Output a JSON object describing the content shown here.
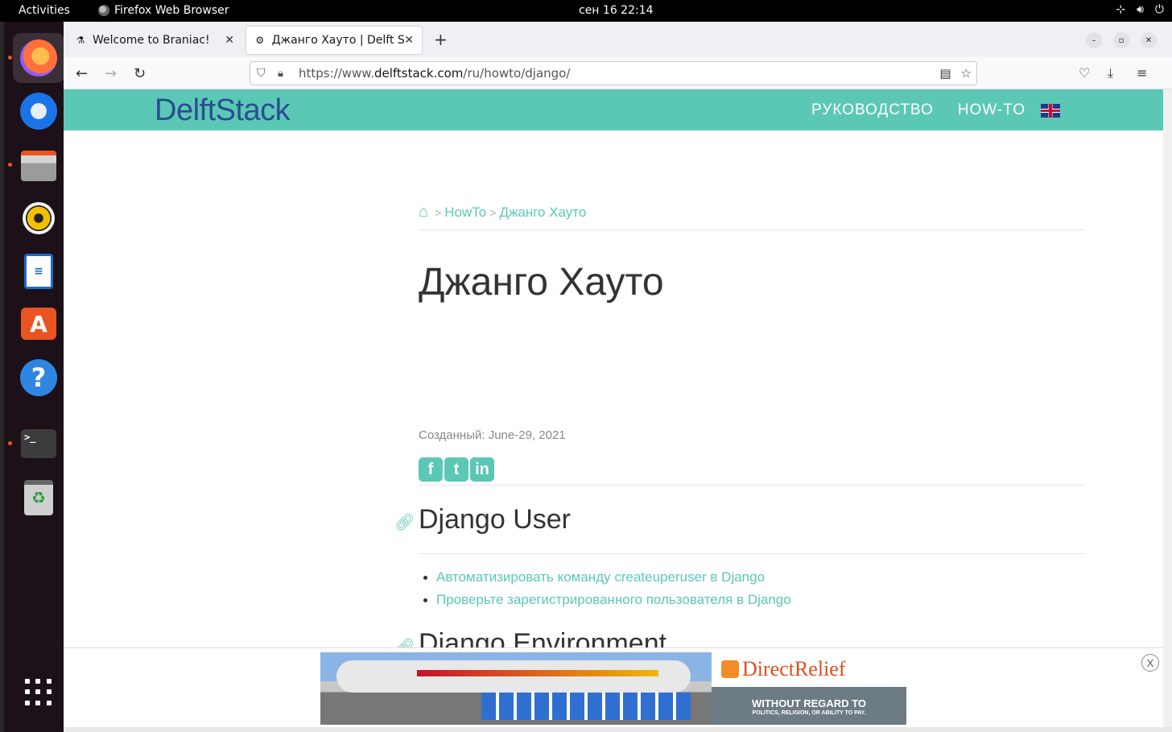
{
  "topbar": {
    "activities": "Activities",
    "app_name": "Firefox Web Browser",
    "clock": "сен 16  22:14"
  },
  "tabs": [
    {
      "title": "Welcome to Braniac!",
      "favicon": "flask-icon"
    },
    {
      "title": "Джанго Хауто | Delft Sta",
      "favicon": "gear-icon"
    }
  ],
  "urlbar": {
    "prefix": "https://www.",
    "domain": "delftstack.com",
    "path": "/ru/howto/django/"
  },
  "site": {
    "logo_delft": "Delft",
    "logo_stack": "Stack",
    "nav": [
      "РУКОВОДСТВО",
      "HOW-TO"
    ]
  },
  "breadcrumb": {
    "sep": ">",
    "items": [
      "HowTo",
      "Джанго Хауто"
    ]
  },
  "page_title": "Джанго Хауто",
  "created": "Созданный: June-29, 2021",
  "share": [
    "f",
    "t",
    "in"
  ],
  "sections": [
    {
      "title": "Django User",
      "links": [
        "Автоматизировать команду createuperuser в Django",
        "Проверьте зарегистрированного пользователя в Django"
      ]
    },
    {
      "title": "Django Environment"
    }
  ],
  "ad": {
    "brand": "DirectRelief",
    "tagline": "WITHOUT REGARD TO",
    "subline": "POLITICS, RELIGION, OR ABILITY TO PAY.",
    "close": "X"
  },
  "colors": {
    "accent": "#5bc8b6",
    "logo": "#2a4e8f",
    "ubuntu_orange": "#e95420"
  }
}
